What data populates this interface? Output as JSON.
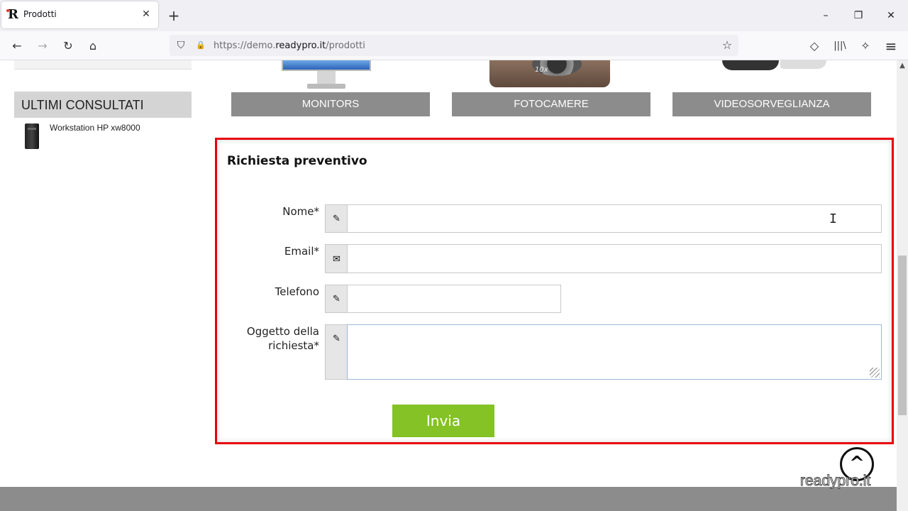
{
  "browser": {
    "tab_title": "Prodotti",
    "tab_icon": "R",
    "close_tab": "✕",
    "new_tab": "+",
    "url_prefix": "https://demo.",
    "url_host": "readypro.it",
    "url_path": "/prodotti",
    "window": {
      "minimize": "–",
      "restore": "❐",
      "close": "✕"
    },
    "nav": {
      "back": "←",
      "forward": "→",
      "reload": "↻",
      "home": "⌂"
    },
    "toolbar": {
      "pocket": "◇",
      "library": "|||\\",
      "extensions": "✧",
      "menu": "≡",
      "bookmark": "☆",
      "shield": "⛉",
      "lock": "🔒"
    }
  },
  "sidebar": {
    "recent_title": "ULTIMI CONSULTATI",
    "recent_items": [
      {
        "label": "Workstation HP xw8000"
      }
    ]
  },
  "categories": [
    {
      "label": "MONITORS"
    },
    {
      "label": "FOTOCAMERE"
    },
    {
      "label": "VIDEOSORVEGLIANZA"
    }
  ],
  "camera_badge": "10x",
  "form": {
    "title": "Richiesta preventivo",
    "fields": [
      {
        "label": "Nome*",
        "icon": "pencil-icon",
        "glyph": "✎",
        "value": ""
      },
      {
        "label": "Email*",
        "icon": "envelope-icon",
        "glyph": "✉",
        "value": ""
      },
      {
        "label": "Telefono",
        "icon": "pencil-icon",
        "glyph": "✎",
        "value": ""
      },
      {
        "label_line1": "Oggetto della",
        "label_line2": "richiesta*",
        "icon": "pencil-icon",
        "glyph": "✎",
        "value": ""
      }
    ],
    "submit": "Invia"
  },
  "back_to_top": "^",
  "watermark": "readypro.it",
  "accent_colors": {
    "highlight": "#e8000b",
    "submit": "#84c225",
    "category": "#8c8c8c"
  }
}
